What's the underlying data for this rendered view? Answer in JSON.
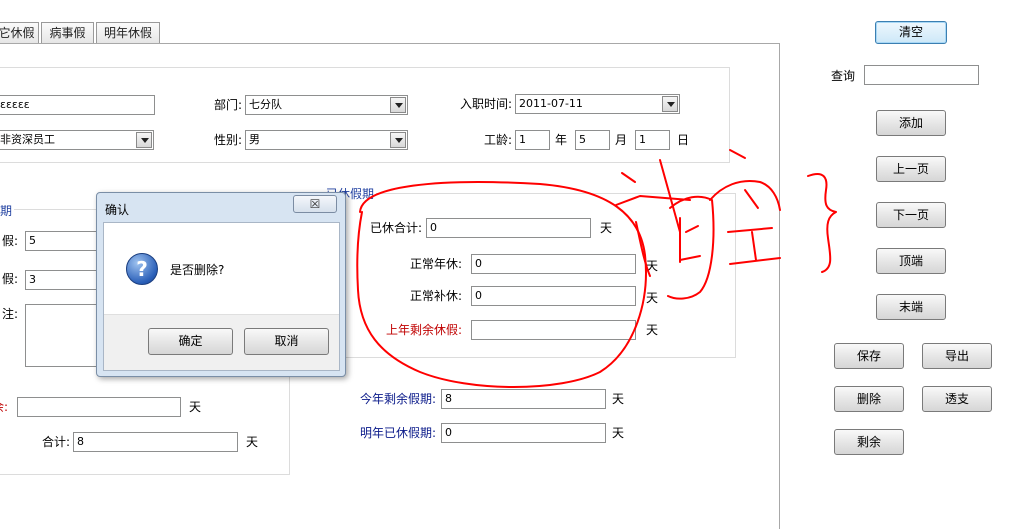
{
  "tabs": [
    "它休假",
    "病事假",
    "明年休假"
  ],
  "form": {
    "name_value": "εεεεε",
    "type_value": "非资深员工",
    "dept_label": "部门:",
    "dept_value": "七分队",
    "gender_label": "性别:",
    "gender_value": "男",
    "hire_label": "入职时间:",
    "hire_value": "2011-07-11",
    "seniority_label": "工龄:",
    "years": "1",
    "year_unit": "年",
    "months": "5",
    "month_unit": "月",
    "days": "1",
    "day_unit": "日"
  },
  "left_group": {
    "title": "期",
    "leave1_label": "假:",
    "leave1_value": "5",
    "leave2_label": "假:",
    "leave2_value": "3",
    "note_label": "注:",
    "remain_label": "余:",
    "remain_value": "",
    "remain_unit": "天",
    "total_label": "合计:",
    "total_value": "8",
    "total_unit": "天"
  },
  "taken_group": {
    "title": "已休假期",
    "total_label": "已休合计:",
    "total_value": "0",
    "normal_annual_label": "正常年休:",
    "normal_annual_value": "0",
    "normal_comp_label": "正常补休:",
    "normal_comp_value": "0",
    "last_year_label": "上年剩余休假:",
    "last_year_value": "",
    "unit": "天"
  },
  "bottom": {
    "this_year_label": "今年剩余假期:",
    "this_year_value": "8",
    "next_year_label": "明年已休假期:",
    "next_year_value": "0",
    "unit": "天"
  },
  "sidebar": {
    "clear": "清空",
    "query_label": "查询",
    "query_value": "",
    "add": "添加",
    "prev": "上一页",
    "next": "下一页",
    "top": "顶端",
    "end": "末端",
    "save": "保存",
    "export": "导出",
    "delete": "删除",
    "overdraft": "透支",
    "remaining": "剩余"
  },
  "dialog": {
    "title": "确认",
    "message": "是否删除?",
    "ok": "确定",
    "cancel": "取消",
    "close_symbol": "☒"
  },
  "colors": {
    "annotation_ink": "#ff0000",
    "group_title": "#1f3fa0",
    "warning_label": "#c00000"
  }
}
